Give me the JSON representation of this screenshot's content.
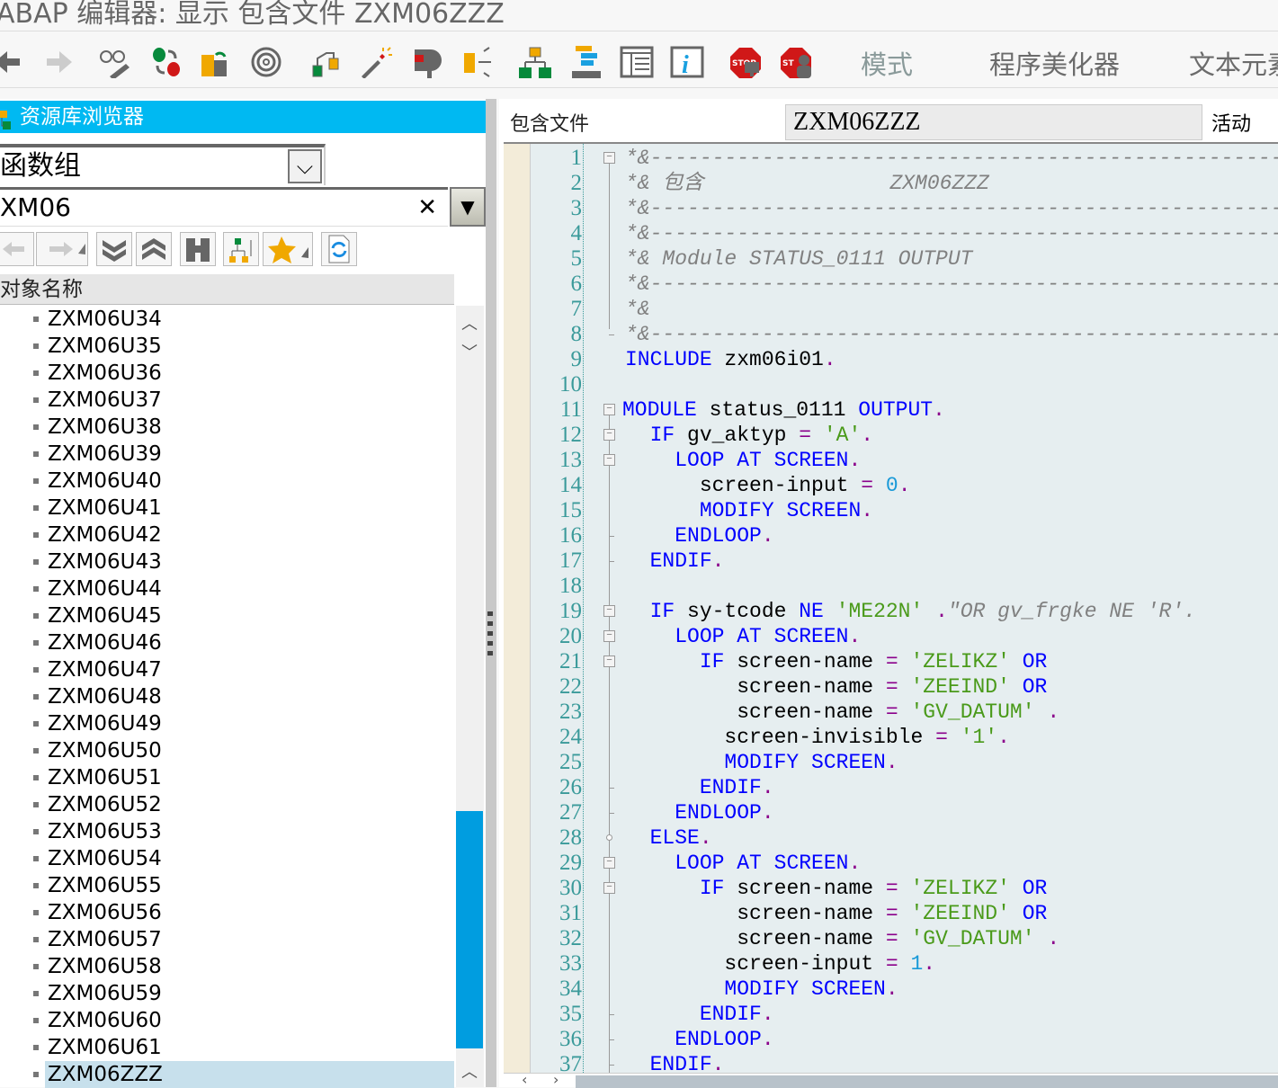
{
  "window": {
    "title": "ABAP 编辑器: 显示 包含文件 ZXM06ZZZ"
  },
  "toolbar": {
    "icons": [
      "back-icon",
      "forward-icon",
      "display-change-icon",
      "active-inactive-icon",
      "other-object-icon",
      "where-used-icon",
      "object-list-icon",
      "enhance-icon",
      "check-icon",
      "navigate-icon",
      "hierarchy-icon",
      "structure-icon",
      "layout-icon",
      "info-icon",
      "stop-breakpoint-icon",
      "stop-user-icon"
    ],
    "pattern_label": "模式",
    "pretty_printer_label": "程序美化器",
    "text_elements_label": "文本元素"
  },
  "browser": {
    "title": "资源库浏览器",
    "object_type": "函数组",
    "object_name": "XM06",
    "column_header": "对象名称",
    "items": [
      "ZXM06U34",
      "ZXM06U35",
      "ZXM06U36",
      "ZXM06U37",
      "ZXM06U38",
      "ZXM06U39",
      "ZXM06U40",
      "ZXM06U41",
      "ZXM06U42",
      "ZXM06U43",
      "ZXM06U44",
      "ZXM06U45",
      "ZXM06U46",
      "ZXM06U47",
      "ZXM06U48",
      "ZXM06U49",
      "ZXM06U50",
      "ZXM06U51",
      "ZXM06U52",
      "ZXM06U53",
      "ZXM06U54",
      "ZXM06U55",
      "ZXM06U56",
      "ZXM06U57",
      "ZXM06U58",
      "ZXM06U59",
      "ZXM06U60",
      "ZXM06U61",
      "ZXM06ZZZ"
    ],
    "selected": "ZXM06ZZZ",
    "accent": "#00b9f2",
    "scroll_accent": "#009de0",
    "selection_color": "#c7e0ec"
  },
  "editor": {
    "include_label": "包含文件",
    "include_name": "ZXM06ZZZ",
    "status": "活动",
    "lines": [
      [
        [
          "c",
          "*&---------------------------------------------------------------------"
        ]
      ],
      [
        [
          "c",
          "*& 包含               ZXM06ZZZ"
        ]
      ],
      [
        [
          "c",
          "*&---------------------------------------------------------------------"
        ]
      ],
      [
        [
          "c",
          "*&---------------------------------------------------------------------"
        ]
      ],
      [
        [
          "c",
          "*& Module STATUS_0111 OUTPUT"
        ]
      ],
      [
        [
          "c",
          "*&---------------------------------------------------------------------"
        ]
      ],
      [
        [
          "c",
          "*&"
        ]
      ],
      [
        [
          "c",
          "*&---------------------------------------------------------------------"
        ]
      ],
      [
        [
          "k",
          "INCLUDE"
        ],
        [
          "t",
          " zxm06i01"
        ],
        [
          "o",
          "."
        ]
      ],
      [],
      [
        [
          "k",
          "MODULE"
        ],
        [
          "t",
          " status_0111 "
        ],
        [
          "k",
          "OUTPUT"
        ],
        [
          "o",
          "."
        ]
      ],
      [
        [
          "t",
          "  "
        ],
        [
          "k",
          "IF"
        ],
        [
          "t",
          " gv_aktyp "
        ],
        [
          "o",
          "="
        ],
        [
          "t",
          " "
        ],
        [
          "s",
          "'A'"
        ],
        [
          "o",
          "."
        ]
      ],
      [
        [
          "t",
          "    "
        ],
        [
          "k",
          "LOOP AT SCREEN"
        ],
        [
          "o",
          "."
        ]
      ],
      [
        [
          "t",
          "      screen-input "
        ],
        [
          "o",
          "="
        ],
        [
          "t",
          " "
        ],
        [
          "n",
          "0"
        ],
        [
          "o",
          "."
        ]
      ],
      [
        [
          "t",
          "      "
        ],
        [
          "k",
          "MODIFY SCREEN"
        ],
        [
          "o",
          "."
        ]
      ],
      [
        [
          "t",
          "    "
        ],
        [
          "k",
          "ENDLOOP"
        ],
        [
          "o",
          "."
        ]
      ],
      [
        [
          "t",
          "  "
        ],
        [
          "k",
          "ENDIF"
        ],
        [
          "o",
          "."
        ]
      ],
      [],
      [
        [
          "t",
          "  "
        ],
        [
          "k",
          "IF"
        ],
        [
          "t",
          " sy-tcode "
        ],
        [
          "k",
          "NE"
        ],
        [
          "t",
          " "
        ],
        [
          "s",
          "'ME22N'"
        ],
        [
          "t",
          " "
        ],
        [
          "o",
          "."
        ],
        [
          "c",
          "\"OR gv_frgke NE 'R'."
        ]
      ],
      [
        [
          "t",
          "    "
        ],
        [
          "k",
          "LOOP AT SCREEN"
        ],
        [
          "o",
          "."
        ]
      ],
      [
        [
          "t",
          "      "
        ],
        [
          "k",
          "IF"
        ],
        [
          "t",
          " screen-name "
        ],
        [
          "o",
          "="
        ],
        [
          "t",
          " "
        ],
        [
          "s",
          "'ZELIKZ'"
        ],
        [
          "t",
          " "
        ],
        [
          "k",
          "OR"
        ]
      ],
      [
        [
          "t",
          "         screen-name "
        ],
        [
          "o",
          "="
        ],
        [
          "t",
          " "
        ],
        [
          "s",
          "'ZEEIND'"
        ],
        [
          "t",
          " "
        ],
        [
          "k",
          "OR"
        ]
      ],
      [
        [
          "t",
          "         screen-name "
        ],
        [
          "o",
          "="
        ],
        [
          "t",
          " "
        ],
        [
          "s",
          "'GV_DATUM'"
        ],
        [
          "t",
          " "
        ],
        [
          "o",
          "."
        ]
      ],
      [
        [
          "t",
          "        screen-invisible "
        ],
        [
          "o",
          "="
        ],
        [
          "t",
          " "
        ],
        [
          "s",
          "'1'"
        ],
        [
          "o",
          "."
        ]
      ],
      [
        [
          "t",
          "        "
        ],
        [
          "k",
          "MODIFY SCREEN"
        ],
        [
          "o",
          "."
        ]
      ],
      [
        [
          "t",
          "      "
        ],
        [
          "k",
          "ENDIF"
        ],
        [
          "o",
          "."
        ]
      ],
      [
        [
          "t",
          "    "
        ],
        [
          "k",
          "ENDLOOP"
        ],
        [
          "o",
          "."
        ]
      ],
      [
        [
          "t",
          "  "
        ],
        [
          "k",
          "ELSE"
        ],
        [
          "o",
          "."
        ]
      ],
      [
        [
          "t",
          "    "
        ],
        [
          "k",
          "LOOP AT SCREEN"
        ],
        [
          "o",
          "."
        ]
      ],
      [
        [
          "t",
          "      "
        ],
        [
          "k",
          "IF"
        ],
        [
          "t",
          " screen-name "
        ],
        [
          "o",
          "="
        ],
        [
          "t",
          " "
        ],
        [
          "s",
          "'ZELIKZ'"
        ],
        [
          "t",
          " "
        ],
        [
          "k",
          "OR"
        ]
      ],
      [
        [
          "t",
          "         screen-name "
        ],
        [
          "o",
          "="
        ],
        [
          "t",
          " "
        ],
        [
          "s",
          "'ZEEIND'"
        ],
        [
          "t",
          " "
        ],
        [
          "k",
          "OR"
        ]
      ],
      [
        [
          "t",
          "         screen-name "
        ],
        [
          "o",
          "="
        ],
        [
          "t",
          " "
        ],
        [
          "s",
          "'GV_DATUM'"
        ],
        [
          "t",
          " "
        ],
        [
          "o",
          "."
        ]
      ],
      [
        [
          "t",
          "        screen-input "
        ],
        [
          "o",
          "="
        ],
        [
          "t",
          " "
        ],
        [
          "n",
          "1"
        ],
        [
          "o",
          "."
        ]
      ],
      [
        [
          "t",
          "        "
        ],
        [
          "k",
          "MODIFY SCREEN"
        ],
        [
          "o",
          "."
        ]
      ],
      [
        [
          "t",
          "      "
        ],
        [
          "k",
          "ENDIF"
        ],
        [
          "o",
          "."
        ]
      ],
      [
        [
          "t",
          "    "
        ],
        [
          "k",
          "ENDLOOP"
        ],
        [
          "o",
          "."
        ]
      ],
      [
        [
          "t",
          "  "
        ],
        [
          "k",
          "ENDIF"
        ],
        [
          "o",
          "."
        ]
      ]
    ]
  }
}
